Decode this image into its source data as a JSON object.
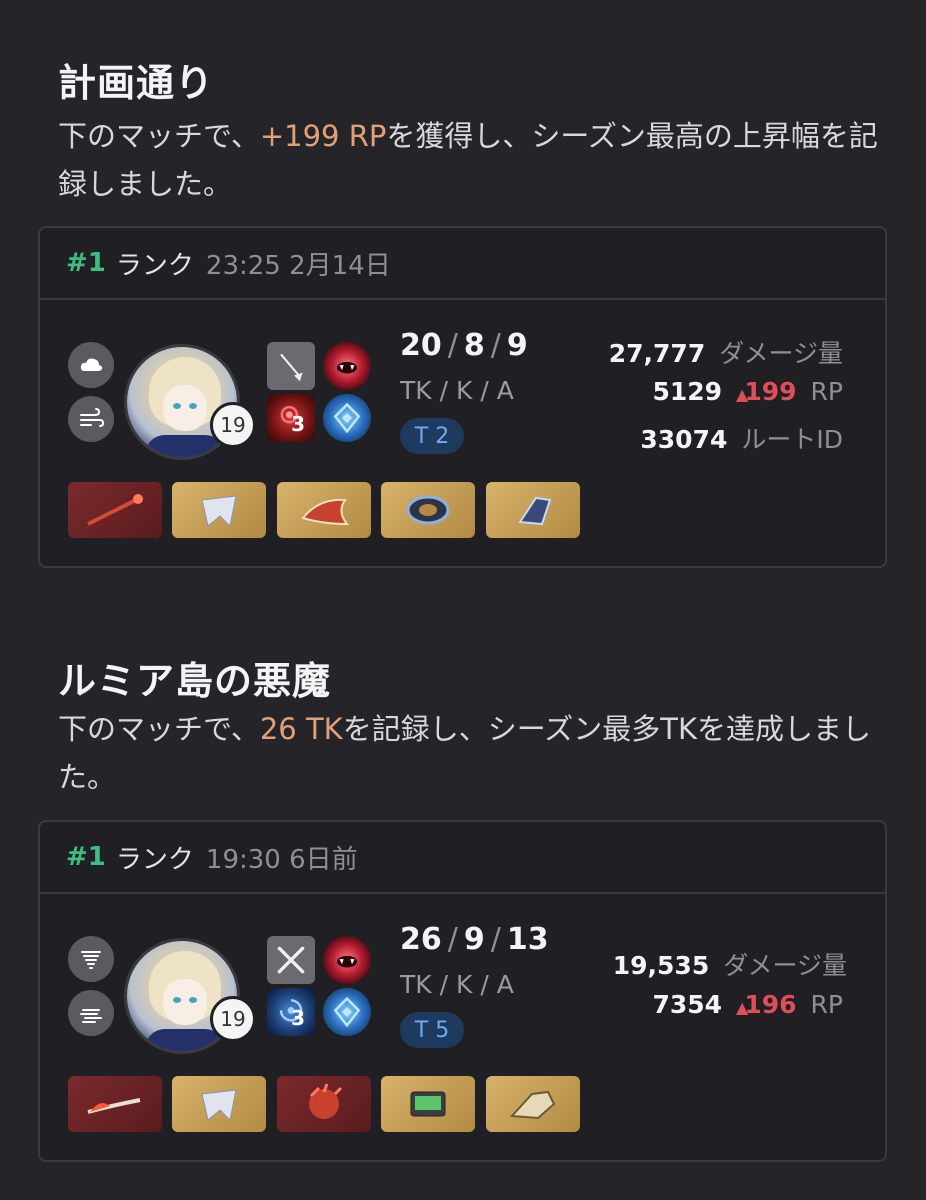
{
  "achievements": [
    {
      "title": "計画通り",
      "desc_pre": "下のマッチで、",
      "desc_hl": "+199 RP",
      "desc_post": "を獲得し、シーズン最高の上昇幅を記録しました。",
      "match": {
        "rank": "#1",
        "mode": "ランク",
        "time": "23:25 2月14日",
        "level": "19",
        "trait_count": "3",
        "kda": {
          "tk": "20",
          "k": "8",
          "a": "9",
          "label": "TK / K / A"
        },
        "tier": "T 2",
        "stats": {
          "damage_value": "27,777",
          "damage_label": "ダメージ量",
          "rp_value": "5129",
          "rp_delta": "199",
          "rp_label": "RP",
          "route_value": "33074",
          "route_label": "ルートID"
        },
        "icons": {
          "left_top": "cloud-icon",
          "left_bottom": "wind-icon",
          "skill1": "rapier-icon",
          "skill2": "vampire-mouth-icon",
          "skill3": "red-aura-icon",
          "skill4": "blue-crest-icon"
        },
        "items": [
          {
            "name": "weapon-item",
            "color": "red"
          },
          {
            "name": "chest-item",
            "color": "gold"
          },
          {
            "name": "head-item",
            "color": "gold"
          },
          {
            "name": "arm-item",
            "color": "gold"
          },
          {
            "name": "leg-item",
            "color": "gold"
          }
        ]
      }
    },
    {
      "title": "ルミア島の悪魔",
      "desc_pre": "下のマッチで、",
      "desc_hl": "26 TK",
      "desc_post": "を記録し、シーズン最多TKを達成しました。",
      "match": {
        "rank": "#1",
        "mode": "ランク",
        "time": "19:30 6日前",
        "level": "19",
        "trait_count": "3",
        "kda": {
          "tk": "26",
          "k": "9",
          "a": "13",
          "label": "TK / K / A"
        },
        "tier": "T 5",
        "stats": {
          "damage_value": "19,535",
          "damage_label": "ダメージ量",
          "rp_value": "7354",
          "rp_delta": "196",
          "rp_label": "RP"
        },
        "icons": {
          "left_top": "tornado-icon",
          "left_bottom": "fog-icon",
          "skill1": "crossed-swords-icon",
          "skill2": "vampire-mouth-icon",
          "skill3": "blue-vortex-icon",
          "skill4": "blue-crest-icon"
        },
        "items": [
          {
            "name": "weapon-item",
            "color": "red"
          },
          {
            "name": "chest-item",
            "color": "gold"
          },
          {
            "name": "head-item",
            "color": "red"
          },
          {
            "name": "arm-item",
            "color": "gold"
          },
          {
            "name": "leg-item",
            "color": "gold"
          }
        ]
      }
    }
  ]
}
